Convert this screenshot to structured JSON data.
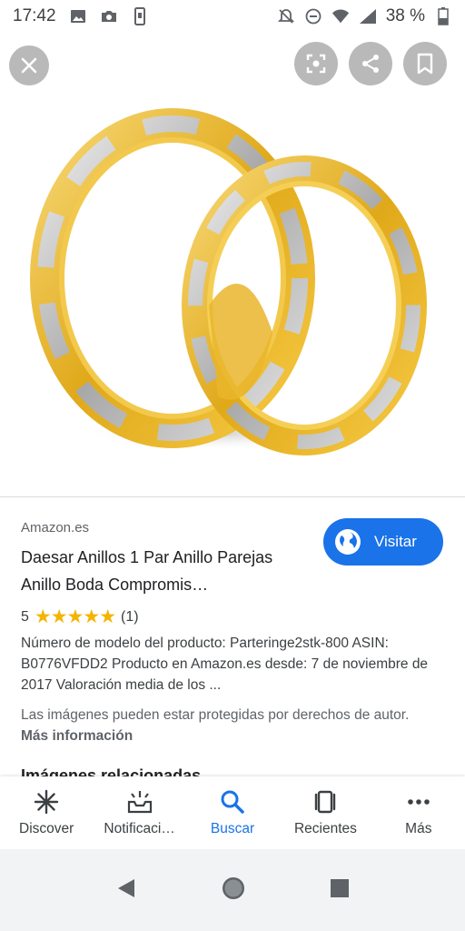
{
  "status_bar": {
    "time": "17:42",
    "battery": "38 %"
  },
  "image_viewer": {
    "close_icon": "close-icon",
    "lens_icon": "lens-icon",
    "share_icon": "share-icon",
    "bookmark_icon": "bookmark-icon"
  },
  "result": {
    "source": "Amazon.es",
    "title": "Daesar Anillos 1 Par Anillo Parejas Anillo Boda Compromis…",
    "visit_label": "Visitar",
    "rating_value": "5",
    "rating_stars": "★★★★★",
    "rating_count": "(1)",
    "description": "Número de modelo del producto: Parteringe2stk-800 ASIN: B0776VFDD2 Producto en Amazon.es desde: 7 de noviembre de 2017 Valoración media de los ...",
    "notice_text": "Las imágenes pueden estar protegidas por derechos de autor.",
    "notice_link": "Más información",
    "related_heading": "Imágenes relacionadas"
  },
  "bottom_nav": {
    "items": [
      {
        "label": "Discover",
        "icon": "discover-icon"
      },
      {
        "label": "Notificaci…",
        "icon": "notifications-icon"
      },
      {
        "label": "Buscar",
        "icon": "search-icon"
      },
      {
        "label": "Recientes",
        "icon": "recents-icon"
      },
      {
        "label": "Más",
        "icon": "more-icon"
      }
    ]
  },
  "colors": {
    "accent": "#1a73e8",
    "star": "#f4b400",
    "gold": "#e8b923",
    "silver": "#c8c8c8"
  }
}
